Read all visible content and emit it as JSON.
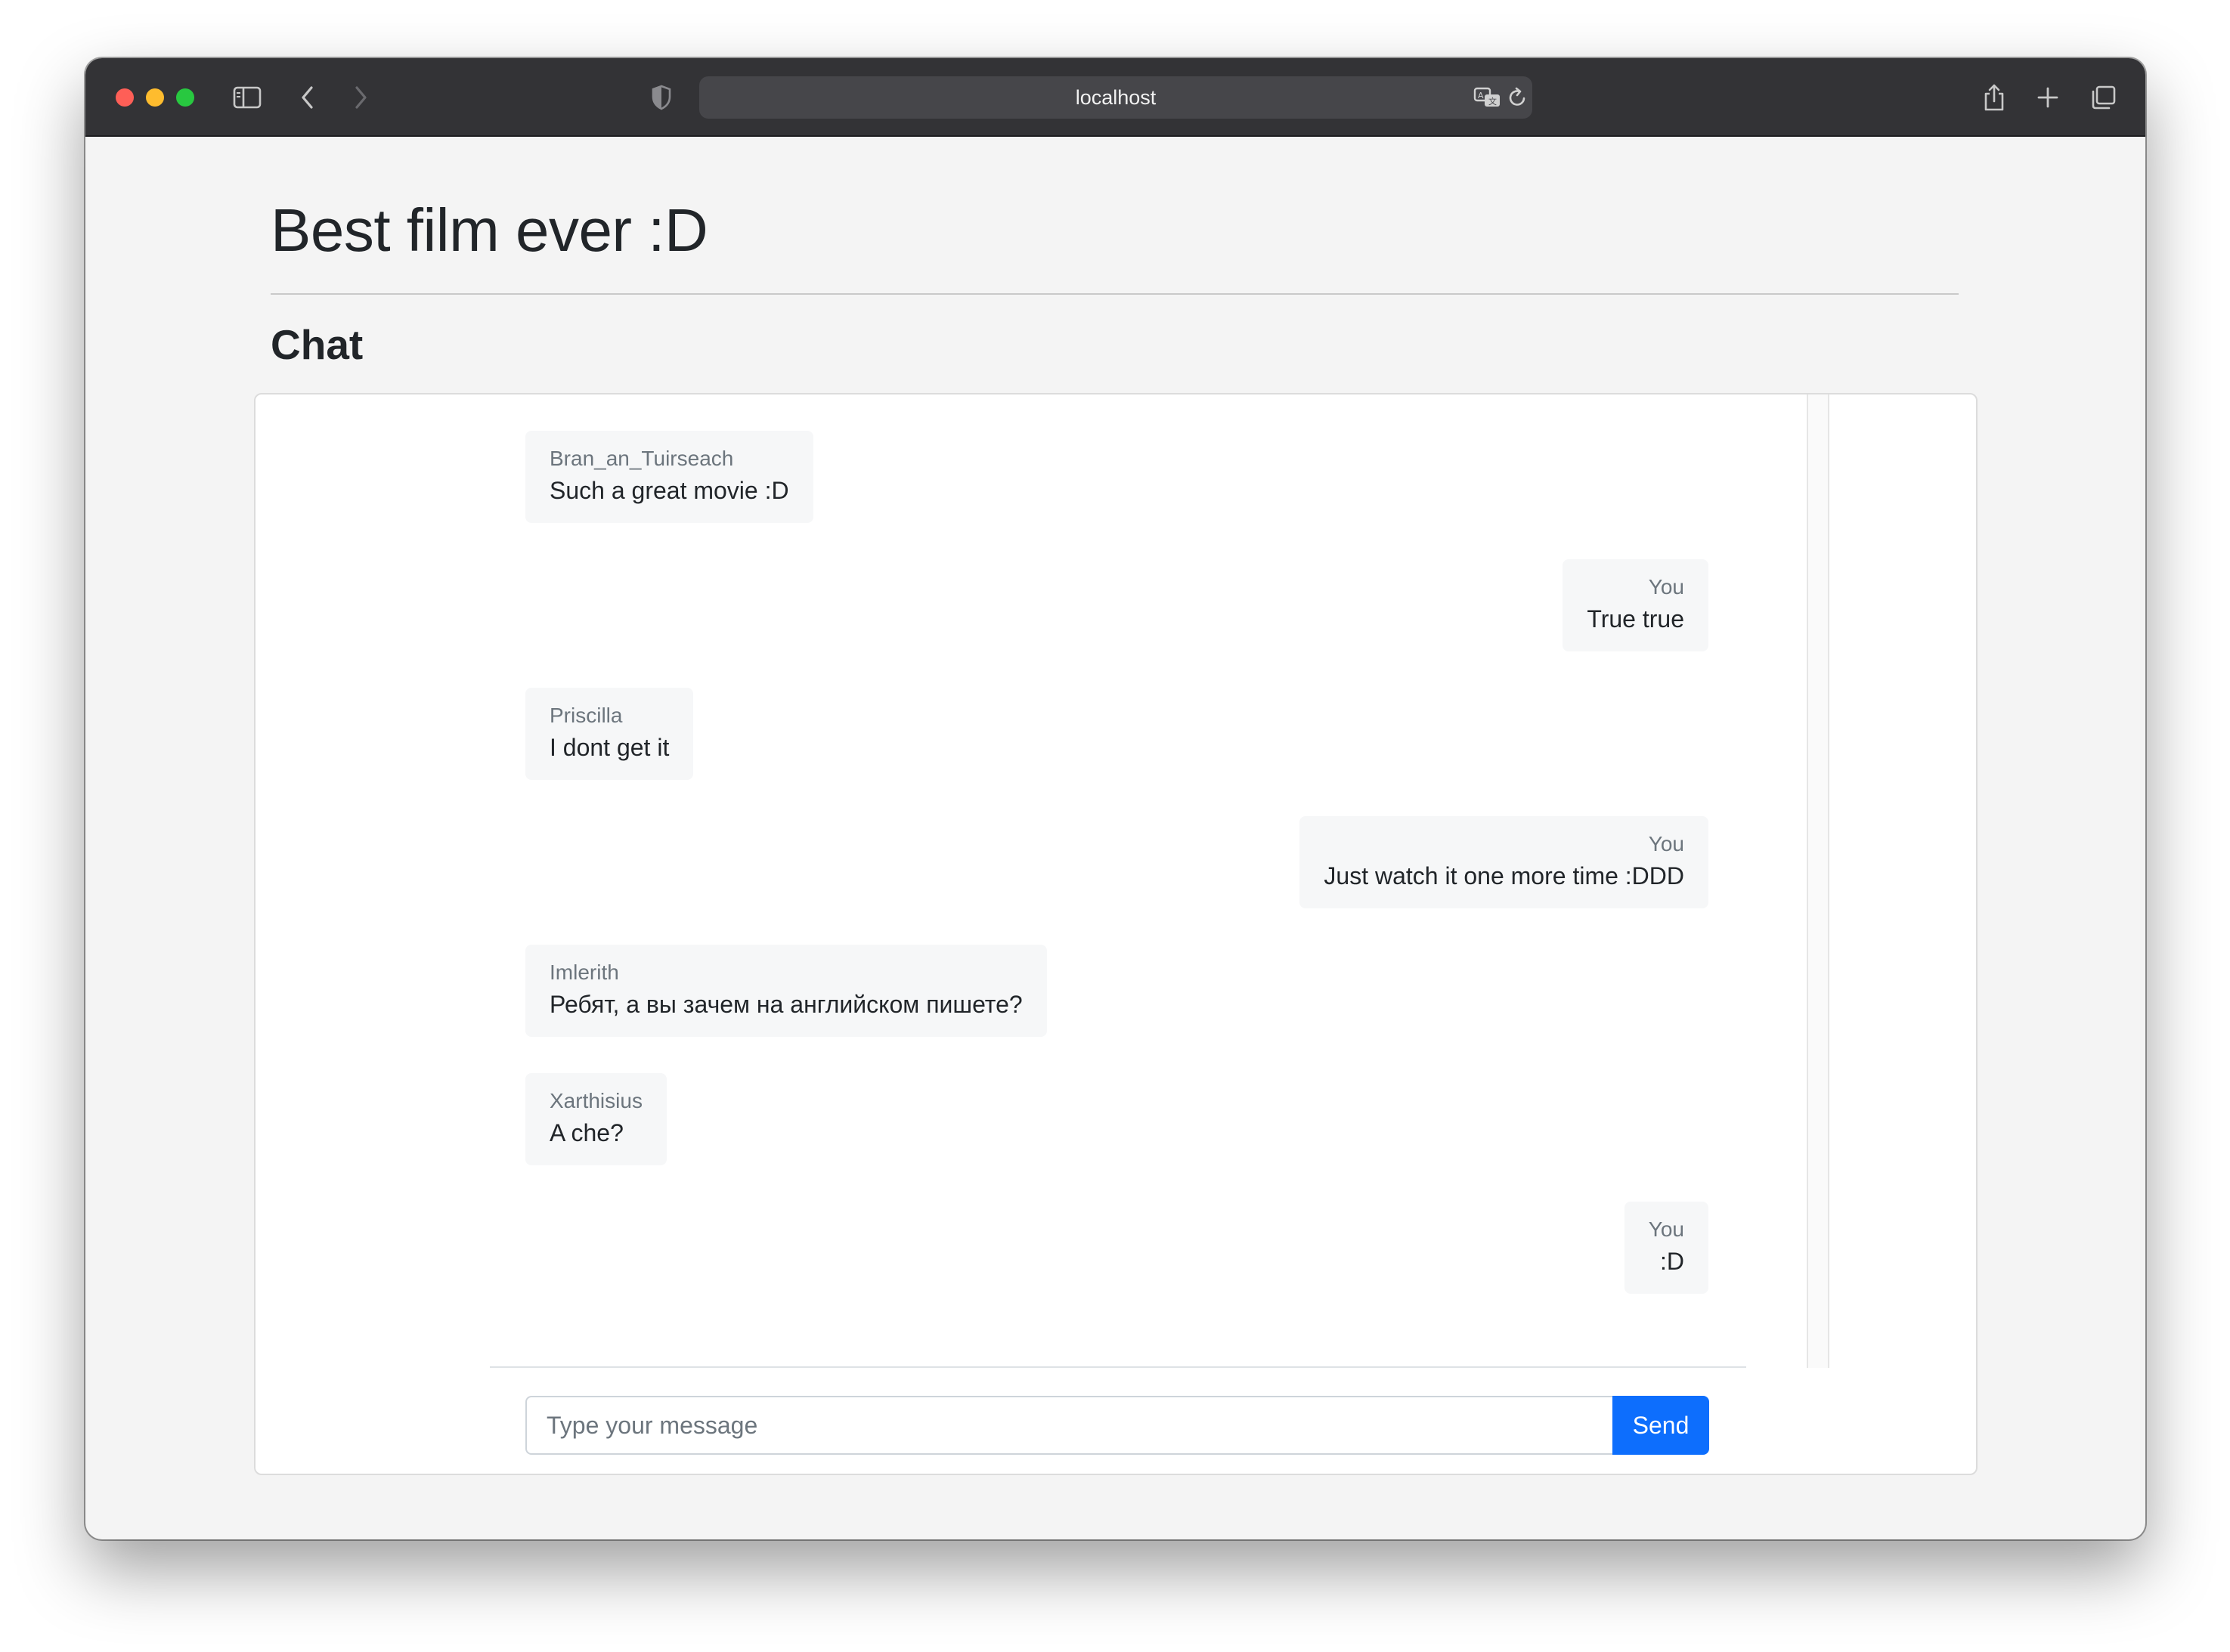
{
  "browser": {
    "url": "localhost"
  },
  "page": {
    "title": "Best film ever :D",
    "section_title": "Chat"
  },
  "chat": {
    "messages": [
      {
        "author": "Bran_an_Tuirseach",
        "text": "Such a great movie :D",
        "side": "left"
      },
      {
        "author": "You",
        "text": "True true",
        "side": "right"
      },
      {
        "author": "Priscilla",
        "text": "I dont get it",
        "side": "left"
      },
      {
        "author": "You",
        "text": "Just watch it one more time :DDD",
        "side": "right"
      },
      {
        "author": "Imlerith",
        "text": "Ребят, а вы зачем на английском пишете?",
        "side": "left"
      },
      {
        "author": "Xarthisius",
        "text": "A che?",
        "side": "left"
      },
      {
        "author": "You",
        "text": ":D",
        "side": "right"
      }
    ],
    "input_placeholder": "Type your message",
    "input_value": "",
    "send_label": "Send"
  },
  "colors": {
    "accent": "#0d6efd",
    "bubble": "#f6f7f8",
    "author_text": "#6c757d"
  }
}
